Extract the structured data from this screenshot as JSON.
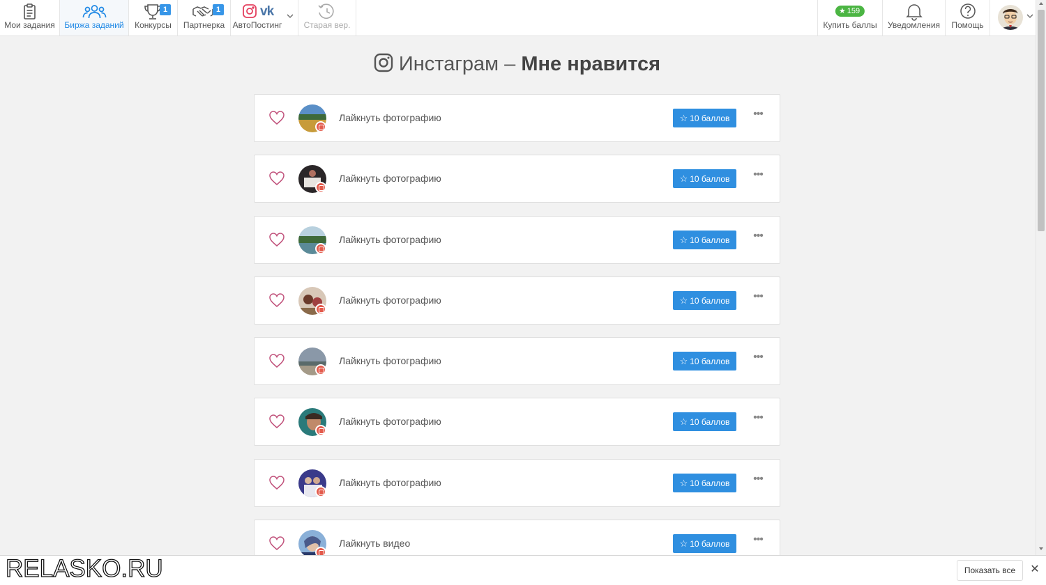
{
  "nav": {
    "my_tasks": "Мои задания",
    "exchange": "Биржа заданий",
    "contests": "Конкурсы",
    "contests_badge": "1",
    "partner": "Партнерка",
    "partner_badge": "1",
    "autoposting": "АвтоПостинг",
    "old_version": "Старая вер.",
    "buy_points": "Купить баллы",
    "points_balance": "159",
    "notifications": "Уведомления",
    "help": "Помощь",
    "active_tab": "exchange"
  },
  "page": {
    "title_prefix": "Инстаграм – ",
    "title_strong": "Мне нравится"
  },
  "tasks": [
    {
      "text": "Лайкнуть фотографию",
      "reward": "10 баллов"
    },
    {
      "text": "Лайкнуть фотографию",
      "reward": "10 баллов"
    },
    {
      "text": "Лайкнуть фотографию",
      "reward": "10 баллов"
    },
    {
      "text": "Лайкнуть фотографию",
      "reward": "10 баллов"
    },
    {
      "text": "Лайкнуть фотографию",
      "reward": "10 баллов"
    },
    {
      "text": "Лайкнуть фотографию",
      "reward": "10 баллов"
    },
    {
      "text": "Лайкнуть фотографию",
      "reward": "10 баллов"
    },
    {
      "text": "Лайкнуть видео",
      "reward": "10 баллов"
    }
  ],
  "download_bar": {
    "watermark": "RELASKO.RU",
    "show_all": "Показать все",
    "close_glyph": "✕"
  },
  "colors": {
    "accent": "#2f8fe0",
    "points_green": "#4bb543",
    "heart": "#c0507a",
    "instagram_badge": "#e35a4b"
  },
  "icons": {
    "more": "•••",
    "star": "☆"
  }
}
